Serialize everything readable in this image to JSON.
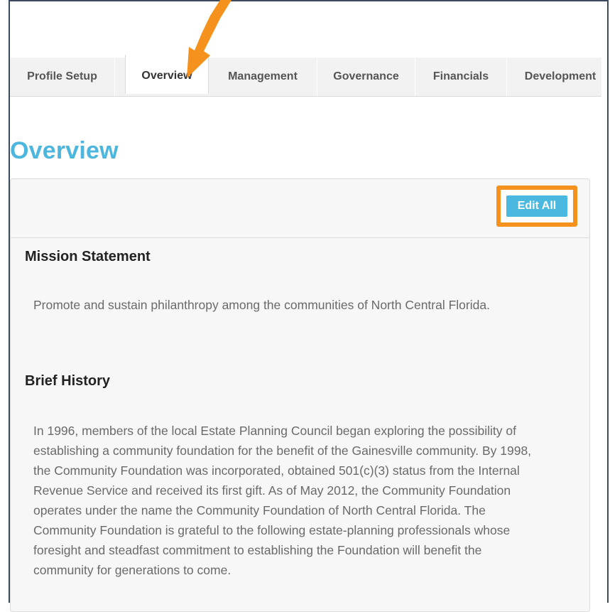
{
  "tabs": [
    {
      "label": "Profile Setup",
      "active": false
    },
    {
      "label": "Overview",
      "active": true
    },
    {
      "label": "Management",
      "active": false
    },
    {
      "label": "Governance",
      "active": false
    },
    {
      "label": "Financials",
      "active": false
    },
    {
      "label": "Development",
      "active": false
    }
  ],
  "page_title": "Overview",
  "toolbar": {
    "edit_all_label": "Edit All"
  },
  "sections": {
    "mission": {
      "heading": "Mission Statement",
      "text": "Promote and sustain philanthropy among the communities of North Central Florida."
    },
    "history": {
      "heading": "Brief History",
      "text": "In 1996, members of the local Estate Planning Council began exploring the possibility of establishing a community foundation for the benefit of the Gainesville community. By 1998, the Community Foundation was incorporated, obtained 501(c)(3) status from the Internal Revenue Service and received its first gift. As of May 2012, the Community Foundation operates under the name the Community Foundation of North Central Florida. The Community Foundation is grateful to the following estate-planning professionals whose foresight and steadfast commitment to establishing the Foundation will benefit the community for generations to come."
    }
  },
  "colors": {
    "accent": "#4db6de",
    "highlight": "#f5921e",
    "button": "#4bb8e0"
  },
  "annotations": {
    "arrow_icon": "orange-arrow-icon",
    "highlight_box": "orange-highlight-box"
  }
}
